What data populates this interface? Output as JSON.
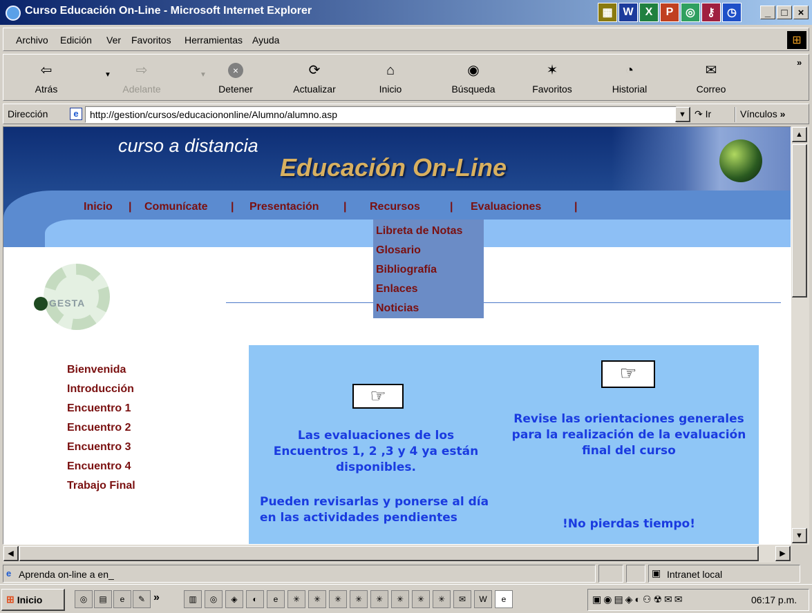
{
  "window": {
    "title": "Curso Educación On-Line - Microsoft Internet Explorer"
  },
  "menu": [
    "Archivo",
    "Edición",
    "Ver",
    "Favoritos",
    "Herramientas",
    "Ayuda"
  ],
  "toolbar": {
    "back": "Atrás",
    "forward": "Adelante",
    "stop": "Detener",
    "refresh": "Actualizar",
    "home": "Inicio",
    "search": "Búsqueda",
    "favorites": "Favoritos",
    "history": "Historial",
    "mail": "Correo"
  },
  "address": {
    "label": "Dirección",
    "url": "http://gestion/cursos/educaciononline/Alumno/alumno.asp",
    "go": "Ir",
    "links": "Vínculos"
  },
  "page": {
    "tagline": "curso a distancia",
    "title": "Educación On-Line",
    "nav": [
      "Inicio",
      "Comunícate",
      "Presentación",
      "Recursos",
      "Evaluaciones"
    ],
    "nav_sep": "|",
    "recursos_menu": [
      "Libreta de Notas",
      "Glosario",
      "Bibliografía",
      "Enlaces",
      "Noticias"
    ],
    "logo_text": "GESTA",
    "sidebar": [
      "Bienvenida",
      "Introducción",
      "Encuentro 1",
      "Encuentro 2",
      "Encuentro 3",
      "Encuentro 4",
      "Trabajo Final"
    ],
    "notice_left_1": "Las evaluaciones de los Encuentros 1, 2 ,3 y 4 ya están disponibles.",
    "notice_left_2": "Pueden revisarlas y ponerse al día en las actividades pendientes",
    "notice_right_1": "Revise las orientaciones generales para la realización de la evaluación final del curso",
    "notice_right_2": "!No pierdas tiempo!"
  },
  "status": {
    "text": "Aprenda on-line a en_",
    "zone": "Intranet local"
  },
  "taskbar": {
    "start": "Inicio",
    "clock": "06:17 p.m."
  },
  "colors": {
    "nav_text": "#7a1010",
    "notice_text": "#1a3be0",
    "panel": "#8fc6f6",
    "banner": "#224c93"
  }
}
